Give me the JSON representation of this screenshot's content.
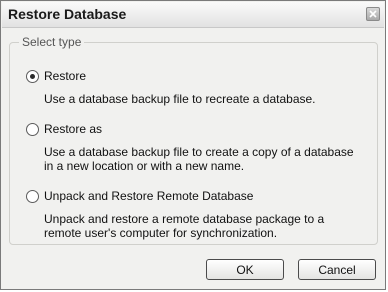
{
  "window": {
    "title": "Restore Database",
    "close_icon": "close-icon"
  },
  "group": {
    "legend": "Select type"
  },
  "options": [
    {
      "label": "Restore",
      "description": "Use a database backup file to recreate a database.",
      "selected": true
    },
    {
      "label": "Restore as",
      "description_lines": [
        "Use a database backup file to create a copy of a database",
        "in a new location or with a new name."
      ],
      "selected": false
    },
    {
      "label": "Unpack and Restore Remote Database",
      "description_lines": [
        "Unpack and restore a remote database package to a",
        "remote user's computer for synchronization."
      ],
      "selected": false
    }
  ],
  "buttons": {
    "ok": "OK",
    "cancel": "Cancel"
  }
}
